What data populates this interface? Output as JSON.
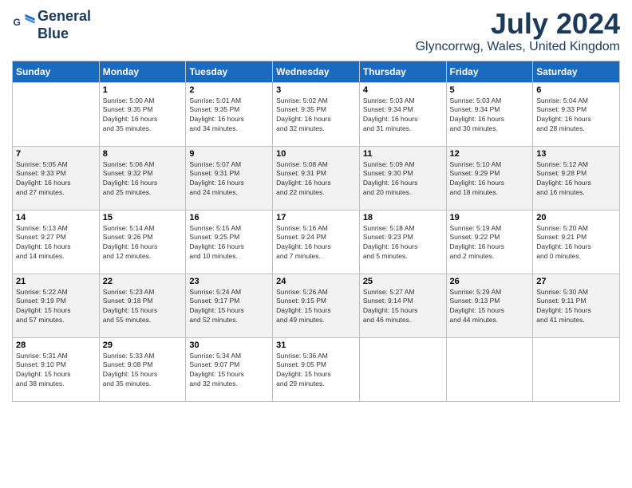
{
  "logo": {
    "line1": "General",
    "line2": "Blue"
  },
  "calendar": {
    "title": "July 2024",
    "subtitle": "Glyncorrwg, Wales, United Kingdom"
  },
  "headers": [
    "Sunday",
    "Monday",
    "Tuesday",
    "Wednesday",
    "Thursday",
    "Friday",
    "Saturday"
  ],
  "weeks": [
    [
      {
        "day": "",
        "info": ""
      },
      {
        "day": "1",
        "info": "Sunrise: 5:00 AM\nSunset: 9:35 PM\nDaylight: 16 hours\nand 35 minutes."
      },
      {
        "day": "2",
        "info": "Sunrise: 5:01 AM\nSunset: 9:35 PM\nDaylight: 16 hours\nand 34 minutes."
      },
      {
        "day": "3",
        "info": "Sunrise: 5:02 AM\nSunset: 9:35 PM\nDaylight: 16 hours\nand 32 minutes."
      },
      {
        "day": "4",
        "info": "Sunrise: 5:03 AM\nSunset: 9:34 PM\nDaylight: 16 hours\nand 31 minutes."
      },
      {
        "day": "5",
        "info": "Sunrise: 5:03 AM\nSunset: 9:34 PM\nDaylight: 16 hours\nand 30 minutes."
      },
      {
        "day": "6",
        "info": "Sunrise: 5:04 AM\nSunset: 9:33 PM\nDaylight: 16 hours\nand 28 minutes."
      }
    ],
    [
      {
        "day": "7",
        "info": "Sunrise: 5:05 AM\nSunset: 9:33 PM\nDaylight: 16 hours\nand 27 minutes."
      },
      {
        "day": "8",
        "info": "Sunrise: 5:06 AM\nSunset: 9:32 PM\nDaylight: 16 hours\nand 25 minutes."
      },
      {
        "day": "9",
        "info": "Sunrise: 5:07 AM\nSunset: 9:31 PM\nDaylight: 16 hours\nand 24 minutes."
      },
      {
        "day": "10",
        "info": "Sunrise: 5:08 AM\nSunset: 9:31 PM\nDaylight: 16 hours\nand 22 minutes."
      },
      {
        "day": "11",
        "info": "Sunrise: 5:09 AM\nSunset: 9:30 PM\nDaylight: 16 hours\nand 20 minutes."
      },
      {
        "day": "12",
        "info": "Sunrise: 5:10 AM\nSunset: 9:29 PM\nDaylight: 16 hours\nand 18 minutes."
      },
      {
        "day": "13",
        "info": "Sunrise: 5:12 AM\nSunset: 9:28 PM\nDaylight: 16 hours\nand 16 minutes."
      }
    ],
    [
      {
        "day": "14",
        "info": "Sunrise: 5:13 AM\nSunset: 9:27 PM\nDaylight: 16 hours\nand 14 minutes."
      },
      {
        "day": "15",
        "info": "Sunrise: 5:14 AM\nSunset: 9:26 PM\nDaylight: 16 hours\nand 12 minutes."
      },
      {
        "day": "16",
        "info": "Sunrise: 5:15 AM\nSunset: 9:25 PM\nDaylight: 16 hours\nand 10 minutes."
      },
      {
        "day": "17",
        "info": "Sunrise: 5:16 AM\nSunset: 9:24 PM\nDaylight: 16 hours\nand 7 minutes."
      },
      {
        "day": "18",
        "info": "Sunrise: 5:18 AM\nSunset: 9:23 PM\nDaylight: 16 hours\nand 5 minutes."
      },
      {
        "day": "19",
        "info": "Sunrise: 5:19 AM\nSunset: 9:22 PM\nDaylight: 16 hours\nand 2 minutes."
      },
      {
        "day": "20",
        "info": "Sunrise: 5:20 AM\nSunset: 9:21 PM\nDaylight: 16 hours\nand 0 minutes."
      }
    ],
    [
      {
        "day": "21",
        "info": "Sunrise: 5:22 AM\nSunset: 9:19 PM\nDaylight: 15 hours\nand 57 minutes."
      },
      {
        "day": "22",
        "info": "Sunrise: 5:23 AM\nSunset: 9:18 PM\nDaylight: 15 hours\nand 55 minutes."
      },
      {
        "day": "23",
        "info": "Sunrise: 5:24 AM\nSunset: 9:17 PM\nDaylight: 15 hours\nand 52 minutes."
      },
      {
        "day": "24",
        "info": "Sunrise: 5:26 AM\nSunset: 9:15 PM\nDaylight: 15 hours\nand 49 minutes."
      },
      {
        "day": "25",
        "info": "Sunrise: 5:27 AM\nSunset: 9:14 PM\nDaylight: 15 hours\nand 46 minutes."
      },
      {
        "day": "26",
        "info": "Sunrise: 5:29 AM\nSunset: 9:13 PM\nDaylight: 15 hours\nand 44 minutes."
      },
      {
        "day": "27",
        "info": "Sunrise: 5:30 AM\nSunset: 9:11 PM\nDaylight: 15 hours\nand 41 minutes."
      }
    ],
    [
      {
        "day": "28",
        "info": "Sunrise: 5:31 AM\nSunset: 9:10 PM\nDaylight: 15 hours\nand 38 minutes."
      },
      {
        "day": "29",
        "info": "Sunrise: 5:33 AM\nSunset: 9:08 PM\nDaylight: 15 hours\nand 35 minutes."
      },
      {
        "day": "30",
        "info": "Sunrise: 5:34 AM\nSunset: 9:07 PM\nDaylight: 15 hours\nand 32 minutes."
      },
      {
        "day": "31",
        "info": "Sunrise: 5:36 AM\nSunset: 9:05 PM\nDaylight: 15 hours\nand 29 minutes."
      },
      {
        "day": "",
        "info": ""
      },
      {
        "day": "",
        "info": ""
      },
      {
        "day": "",
        "info": ""
      }
    ]
  ]
}
